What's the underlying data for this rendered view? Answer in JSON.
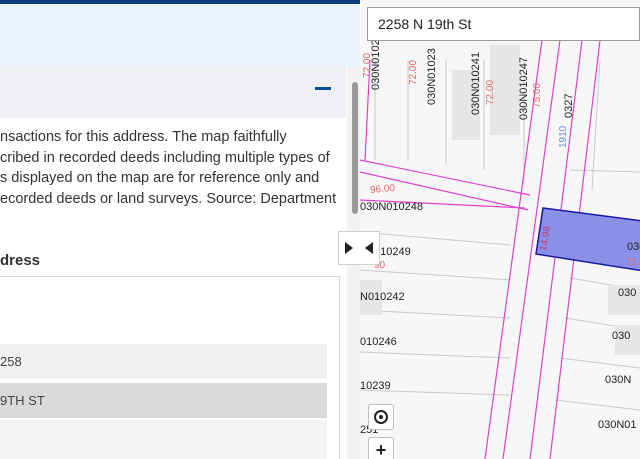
{
  "header": {
    "accent_color": "#0b3a78",
    "collapse_icon": "minus-icon"
  },
  "description": {
    "text": "nsactions for this address. The map faithfully\ncribed in recorded deeds including multiple types of\ns displayed on the map are for reference only and\necorded deeds or land surveys. Source: Department"
  },
  "address_section": {
    "label": "dress",
    "rows": [
      "258",
      "9TH ST",
      ""
    ]
  },
  "map": {
    "search_value": "2258 N 19th St",
    "highlight_color": "#8a8fe8",
    "parcel_labels": [
      "030N0102",
      "030N01023",
      "030N010241",
      "030N010247",
      "0327",
      "030N010248",
      "010249",
      "N010242",
      "010246",
      "10239",
      "030",
      "030",
      "030",
      "030N",
      "030N",
      "030N01",
      "251"
    ],
    "dimension_labels": [
      "72.00",
      "72.00",
      "72.00",
      "72.00",
      "75.00",
      "96.00",
      "90",
      "1910",
      "14.98",
      "71"
    ]
  },
  "controls": {
    "toggle_left_icon": "triangle-right-icon",
    "toggle_right_icon": "triangle-left-icon",
    "locate_icon": "locate-icon",
    "zoom_in_label": "+"
  }
}
